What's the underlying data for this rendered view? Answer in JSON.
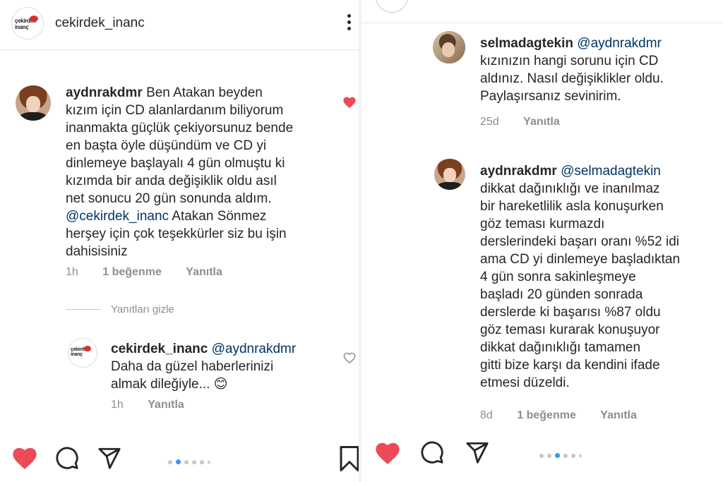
{
  "left": {
    "header": {
      "username": "cekirdek_inanc",
      "logo_text": "ÇEKİRDEK İNANÇ"
    },
    "comment": {
      "username": "aydnrakdmr",
      "text_lines": [
        "Ben Atakan beyden",
        "kızım için CD alanlardanım biliyorum",
        "inanmakta güçlük çekiyorsunuz bende",
        "en başta öyle düşündüm ve CD yi",
        "dinlemeye başlayalı 4 gün olmuştu ki",
        "kızımda bir anda değişiklik oldu asıl",
        "net sonucu 20 gün sonunda aldım."
      ],
      "mention": "@cekirdek_inanc",
      "text_after_mention": "Atakan Sönmez",
      "text_lines_end": [
        "herşey için çok teşekkürler siz bu işin",
        "dahisisiniz"
      ],
      "time": "1h",
      "likes": "1 beğenme",
      "reply": "Yanıtla",
      "liked_color": "#ed4956"
    },
    "hide_replies": "Yanıtları gizle",
    "reply": {
      "username": "cekirdek_inanc",
      "mention": "@aydnrakdmr",
      "text_lines": [
        "Daha da güzel haberlerinizi",
        "almak dileğiyle..."
      ],
      "emoji": "😊",
      "time": "1h",
      "reply": "Yanıtla"
    },
    "bottom": {
      "heart_icon": "heart-filled-icon",
      "comment_icon": "comment-icon",
      "share_icon": "send-icon",
      "bookmark_icon": "bookmark-icon",
      "heart_color": "#ed4956",
      "active_dot_color": "#3897f0"
    }
  },
  "right": {
    "comment1": {
      "username": "selmadagtekin",
      "mention": "@aydnrakdmr",
      "text_lines": [
        "kızınızın hangi sorunu için CD",
        "aldınız. Nasıl değişiklikler oldu.",
        "Paylaşırsanız sevinirim."
      ],
      "time": "25d",
      "reply": "Yanıtla"
    },
    "comment2": {
      "username": "aydnrakdmr",
      "mention": "@selmadagtekin",
      "text_lines": [
        "dikkat dağınıklığı ve inanılmaz",
        "bir hareketlilik asla konuşurken",
        "göz teması kurmazdı",
        "derslerindeki başarı oranı %52 idi",
        "ama CD yi dinlemeye başladıktan",
        "4 gün sonra sakinleşmeye",
        "başladı 20 günden sonrada",
        "derslerde ki başarısı %87 oldu",
        "göz teması kurarak konuşuyor",
        "dikkat dağınıklığı tamamen",
        "gitti bize karşı da kendini ifade",
        "etmesi düzeldi."
      ],
      "time": "8d",
      "likes": "1 beğenme",
      "reply": "Yanıtla"
    }
  }
}
